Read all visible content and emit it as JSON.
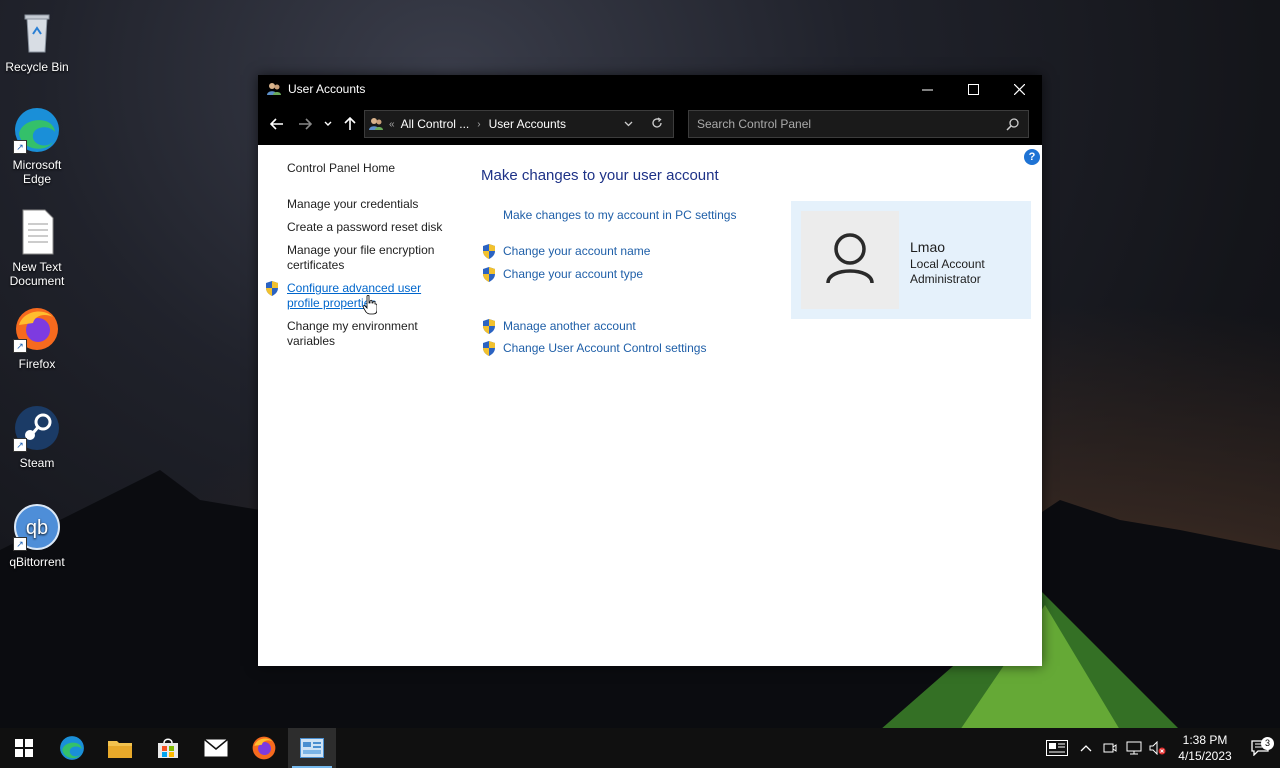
{
  "desktop": {
    "icons": [
      {
        "label": "Recycle Bin",
        "icon": "recycle-bin-icon"
      },
      {
        "label": "Microsoft Edge",
        "icon": "edge-icon"
      },
      {
        "label": "New Text Document",
        "icon": "text-document-icon"
      },
      {
        "label": "Firefox",
        "icon": "firefox-icon"
      },
      {
        "label": "Steam",
        "icon": "steam-icon"
      },
      {
        "label": "qBittorrent",
        "icon": "qbittorrent-icon"
      }
    ]
  },
  "window": {
    "title": "User Accounts",
    "address": {
      "crumb1": "All Control ...",
      "crumb2": "User Accounts",
      "prefix": "«",
      "separator": "›"
    },
    "search_placeholder": "Search Control Panel",
    "help_label": "?"
  },
  "sidebar": {
    "home": "Control Panel Home",
    "items": [
      {
        "label": "Manage your credentials"
      },
      {
        "label": "Create a password reset disk"
      },
      {
        "label": "Manage your file encryption certificates"
      },
      {
        "label": "Configure advanced user profile properties",
        "shield": true
      },
      {
        "label": "Change my environment variables"
      }
    ]
  },
  "main": {
    "heading": "Make changes to your user account",
    "links": [
      {
        "label": "Make changes to my account in PC settings",
        "shield": false
      },
      {
        "label": "Change your account name",
        "shield": true
      },
      {
        "label": "Change your account type",
        "shield": true
      },
      {
        "label": "Manage another account",
        "shield": true
      },
      {
        "label": "Change User Account Control settings",
        "shield": true
      }
    ]
  },
  "account": {
    "name": "Lmao",
    "type": "Local Account",
    "role": "Administrator"
  },
  "taskbar": {
    "clock_time": "1:38 PM",
    "clock_date": "4/15/2023",
    "notification_count": "3",
    "items": [
      "start-icon",
      "edge-icon",
      "file-explorer-icon",
      "store-icon",
      "mail-icon",
      "firefox-icon",
      "control-panel-icon"
    ]
  },
  "colors": {
    "link": "#1f5fa8",
    "heading": "#1e3287",
    "account_bg": "#e5f1fb",
    "accent": "#76b9ed"
  }
}
